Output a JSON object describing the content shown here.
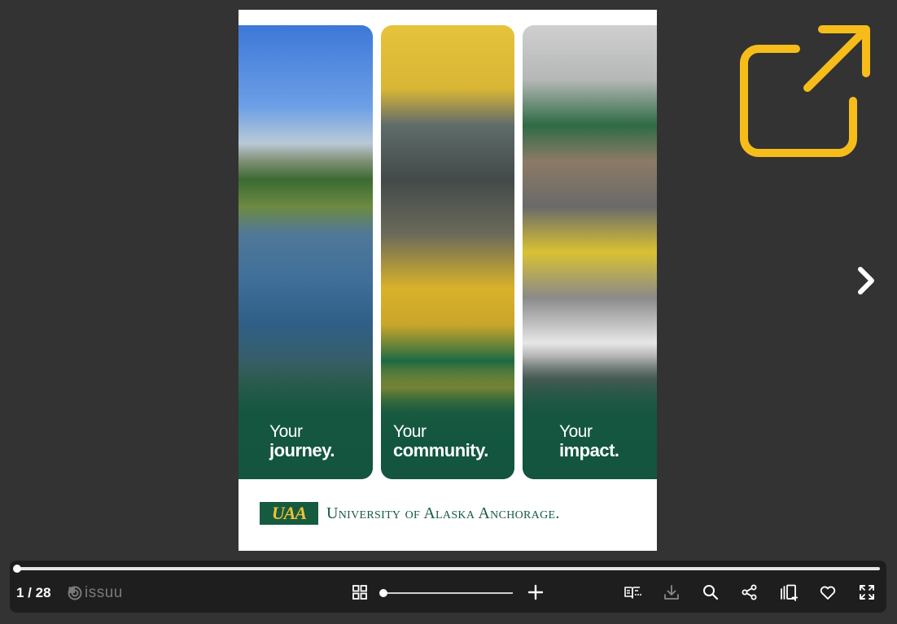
{
  "document": {
    "panels": [
      {
        "line1": "Your",
        "line2": "journey."
      },
      {
        "line1": "Your",
        "line2": "community."
      },
      {
        "line1": "Your",
        "line2": "impact."
      }
    ],
    "logo_mark": "UAA",
    "logo_text": "University of Alaska Anchorage."
  },
  "toolbar": {
    "page_indicator": "1 / 28",
    "brand": "issuu",
    "progress": 0.0,
    "zoom_level": 0.0
  },
  "colors": {
    "accent": "#f6bd1a",
    "background": "#333333",
    "toolbar": "#1e1e1e",
    "uaa_green": "#165b40",
    "uaa_gold": "#f2c230"
  },
  "icons": {
    "open_external": "open-external-icon",
    "next_page": "chevron-right-icon",
    "grid": "grid-view-icon",
    "zoom_in": "plus-icon",
    "reader": "reader-mode-icon",
    "download": "download-icon",
    "search": "search-icon",
    "share": "share-icon",
    "add_to_stack": "add-to-stack-icon",
    "like": "heart-icon",
    "fullscreen": "fullscreen-icon"
  }
}
